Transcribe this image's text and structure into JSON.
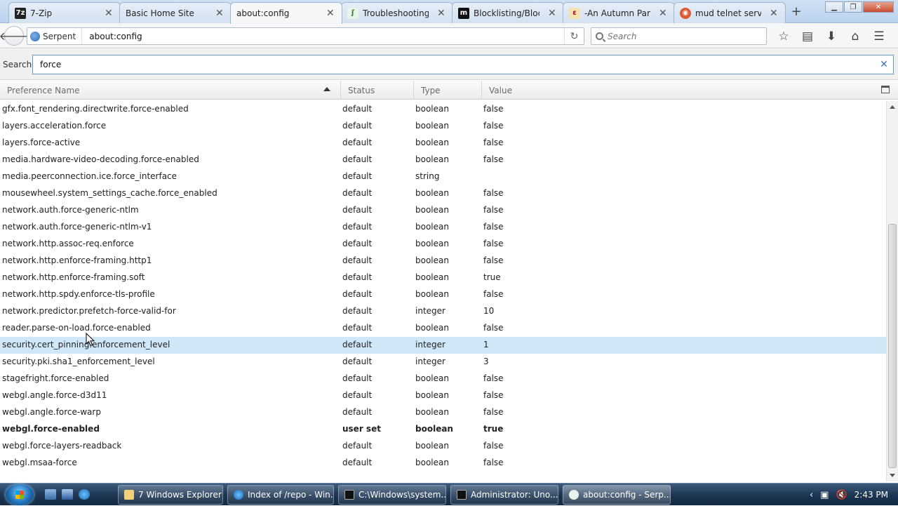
{
  "tabs": [
    {
      "label": "7-Zip",
      "icon": "7zip-icon",
      "active": false
    },
    {
      "label": "Basic Home Site",
      "icon": "blank-page-icon",
      "active": false
    },
    {
      "label": "about:config",
      "icon": "blank-page-icon",
      "active": true
    },
    {
      "label": "Troubleshooting I",
      "icon": "serpent-icon",
      "active": false
    },
    {
      "label": "Blocklisting/Block",
      "icon": "mozilla-m-icon",
      "active": false
    },
    {
      "label": "-An Autumn Para",
      "icon": "ao3-icon",
      "active": false
    },
    {
      "label": "mud telnet server",
      "icon": "duckduckgo-icon",
      "active": false
    }
  ],
  "navbar": {
    "identity_label": "Serpent",
    "url": "about:config",
    "search_placeholder": "Search"
  },
  "filter": {
    "label": "Search:",
    "value": "force"
  },
  "columns": {
    "name": "Preference Name",
    "status": "Status",
    "type": "Type",
    "value": "Value"
  },
  "rows": [
    {
      "name": "gfx.font_rendering.directwrite.force-enabled",
      "status": "default",
      "type": "boolean",
      "value": "false"
    },
    {
      "name": "layers.acceleration.force",
      "status": "default",
      "type": "boolean",
      "value": "false"
    },
    {
      "name": "layers.force-active",
      "status": "default",
      "type": "boolean",
      "value": "false"
    },
    {
      "name": "media.hardware-video-decoding.force-enabled",
      "status": "default",
      "type": "boolean",
      "value": "false"
    },
    {
      "name": "media.peerconnection.ice.force_interface",
      "status": "default",
      "type": "string",
      "value": ""
    },
    {
      "name": "mousewheel.system_settings_cache.force_enabled",
      "status": "default",
      "type": "boolean",
      "value": "false"
    },
    {
      "name": "network.auth.force-generic-ntlm",
      "status": "default",
      "type": "boolean",
      "value": "false"
    },
    {
      "name": "network.auth.force-generic-ntlm-v1",
      "status": "default",
      "type": "boolean",
      "value": "false"
    },
    {
      "name": "network.http.assoc-req.enforce",
      "status": "default",
      "type": "boolean",
      "value": "false"
    },
    {
      "name": "network.http.enforce-framing.http1",
      "status": "default",
      "type": "boolean",
      "value": "false"
    },
    {
      "name": "network.http.enforce-framing.soft",
      "status": "default",
      "type": "boolean",
      "value": "true"
    },
    {
      "name": "network.http.spdy.enforce-tls-profile",
      "status": "default",
      "type": "boolean",
      "value": "false"
    },
    {
      "name": "network.predictor.prefetch-force-valid-for",
      "status": "default",
      "type": "integer",
      "value": "10"
    },
    {
      "name": "reader.parse-on-load.force-enabled",
      "status": "default",
      "type": "boolean",
      "value": "false"
    },
    {
      "name": "security.cert_pinning.enforcement_level",
      "status": "default",
      "type": "integer",
      "value": "1",
      "selected": true
    },
    {
      "name": "security.pki.sha1_enforcement_level",
      "status": "default",
      "type": "integer",
      "value": "3"
    },
    {
      "name": "stagefright.force-enabled",
      "status": "default",
      "type": "boolean",
      "value": "false"
    },
    {
      "name": "webgl.angle.force-d3d11",
      "status": "default",
      "type": "boolean",
      "value": "false"
    },
    {
      "name": "webgl.angle.force-warp",
      "status": "default",
      "type": "boolean",
      "value": "false"
    },
    {
      "name": "webgl.force-enabled",
      "status": "user set",
      "type": "boolean",
      "value": "true",
      "user_set": true
    },
    {
      "name": "webgl.force-layers-readback",
      "status": "default",
      "type": "boolean",
      "value": "false"
    },
    {
      "name": "webgl.msaa-force",
      "status": "default",
      "type": "boolean",
      "value": "false"
    }
  ],
  "taskbar": {
    "buttons": [
      {
        "label": "7 Windows Explorer",
        "icon": "folder-icon"
      },
      {
        "label": "Index of /repo - Win...",
        "icon": "ie-icon"
      },
      {
        "label": "C:\\Windows\\system...",
        "icon": "cmd-icon"
      },
      {
        "label": "Administrator:  Uno...",
        "icon": "cmd-icon"
      },
      {
        "label": "about:config - Serp...",
        "icon": "serpent-icon"
      }
    ],
    "clock": "2:43 PM"
  },
  "colors": {
    "selected_row": "#cfe7f7",
    "filter_border": "#5b9bd5",
    "taskbar": "#1c3451"
  }
}
